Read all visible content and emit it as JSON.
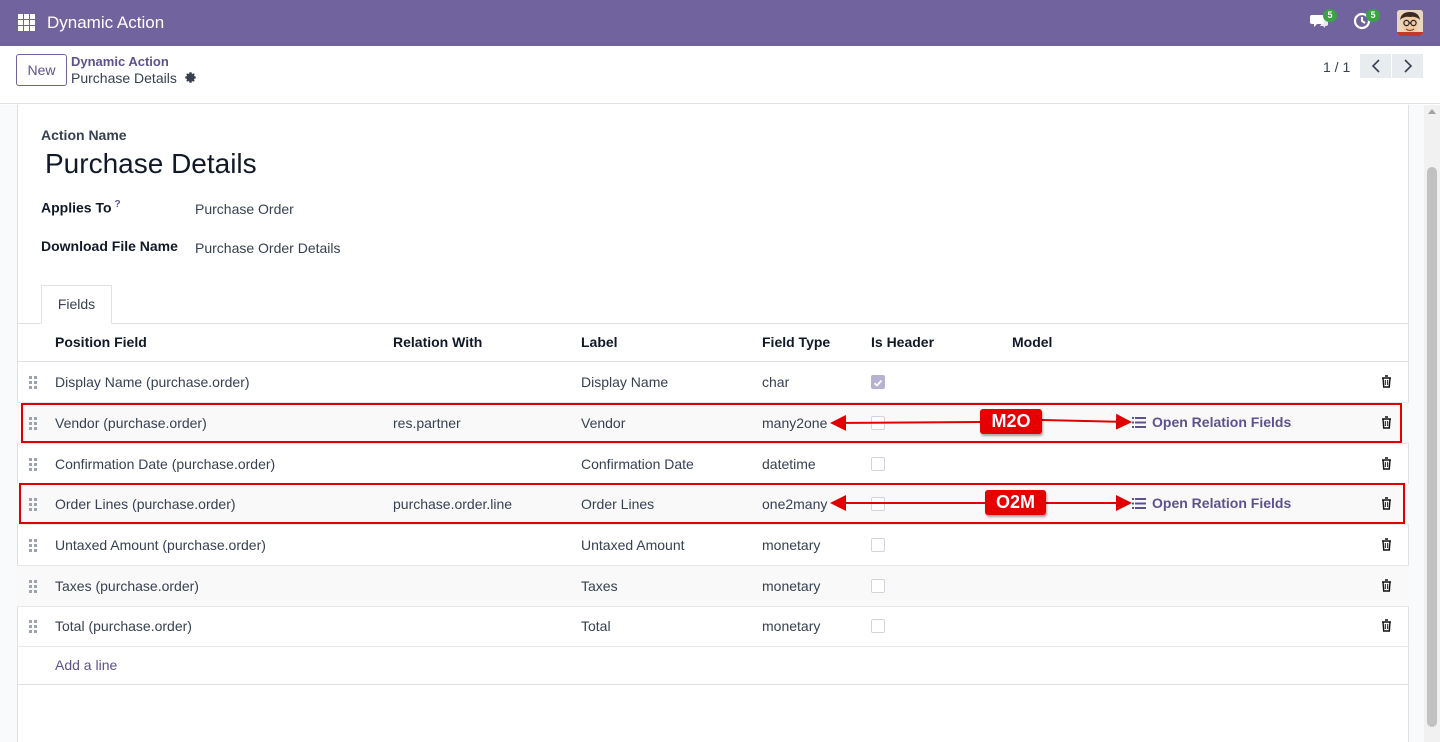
{
  "navbar": {
    "app_title": "Dynamic Action",
    "chat_badge": "5",
    "activity_badge": "5"
  },
  "control_panel": {
    "new_label": "New",
    "breadcrumb_parent": "Dynamic Action",
    "breadcrumb_current": "Purchase Details",
    "pager": "1 / 1"
  },
  "form": {
    "action_name_label": "Action Name",
    "action_name": "Purchase Details",
    "applies_to_label": "Applies To",
    "applies_to_help": "?",
    "applies_to": "Purchase Order",
    "download_label": "Download File Name",
    "download_name": "Purchase Order Details"
  },
  "tabs": [
    {
      "label": "Fields"
    }
  ],
  "table": {
    "headers": {
      "position_field": "Position Field",
      "relation_with": "Relation With",
      "label": "Label",
      "field_type": "Field Type",
      "is_header": "Is Header",
      "model": "Model"
    },
    "rows": [
      {
        "position_field": "Display Name (purchase.order)",
        "relation_with": "",
        "label": "Display Name",
        "field_type": "char",
        "is_header": true,
        "model": ""
      },
      {
        "position_field": "Vendor (purchase.order)",
        "relation_with": "res.partner",
        "label": "Vendor",
        "field_type": "many2one",
        "is_header": false,
        "model": "Open Relation Fields"
      },
      {
        "position_field": "Confirmation Date (purchase.order)",
        "relation_with": "",
        "label": "Confirmation Date",
        "field_type": "datetime",
        "is_header": false,
        "model": ""
      },
      {
        "position_field": "Order Lines (purchase.order)",
        "relation_with": "purchase.order.line",
        "label": "Order Lines",
        "field_type": "one2many",
        "is_header": false,
        "model": "Open Relation Fields"
      },
      {
        "position_field": "Untaxed Amount (purchase.order)",
        "relation_with": "",
        "label": "Untaxed Amount",
        "field_type": "monetary",
        "is_header": false,
        "model": ""
      },
      {
        "position_field": "Taxes (purchase.order)",
        "relation_with": "",
        "label": "Taxes",
        "field_type": "monetary",
        "is_header": false,
        "model": ""
      },
      {
        "position_field": "Total (purchase.order)",
        "relation_with": "",
        "label": "Total",
        "field_type": "monetary",
        "is_header": false,
        "model": ""
      }
    ],
    "add_line": "Add a line"
  },
  "annotations": {
    "m2o_tag": "M2O",
    "o2m_tag": "O2M",
    "color": "#e60000"
  },
  "colors": {
    "navbar": "#71639e",
    "accent": "#5f518e",
    "badge": "#3aa344"
  }
}
